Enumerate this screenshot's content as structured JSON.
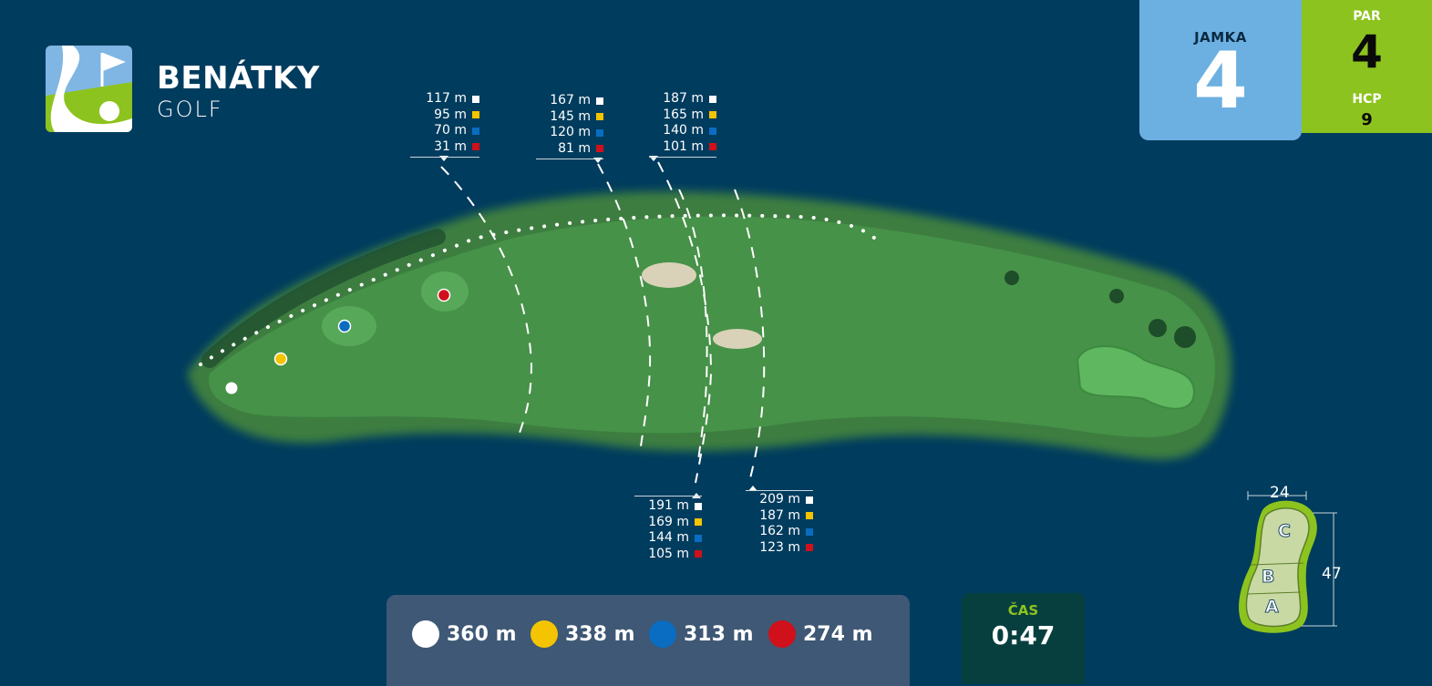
{
  "brand": {
    "name": "BENÁTKY",
    "subtitle": "GOLF"
  },
  "hole": {
    "label": "JAMKA",
    "number": "4"
  },
  "par": {
    "label": "PAR",
    "value": "4"
  },
  "hcp": {
    "label": "HCP",
    "value": "9"
  },
  "tee_colors": {
    "white": "#ffffff",
    "yellow": "#f5c400",
    "blue": "#0a6dc2",
    "red": "#d0101a"
  },
  "markers": [
    {
      "rows": [
        "117 m",
        "95 m",
        "70 m",
        "31 m"
      ]
    },
    {
      "rows": [
        "167 m",
        "145 m",
        "120 m",
        "81 m"
      ]
    },
    {
      "rows": [
        "187 m",
        "165 m",
        "140 m",
        "101 m"
      ]
    },
    {
      "rows": [
        "191 m",
        "169 m",
        "144 m",
        "105 m"
      ]
    },
    {
      "rows": [
        "209 m",
        "187 m",
        "162 m",
        "123 m"
      ]
    }
  ],
  "totals": [
    {
      "tee": "white",
      "distance": "360 m"
    },
    {
      "tee": "yellow",
      "distance": "338 m"
    },
    {
      "tee": "blue",
      "distance": "313 m"
    },
    {
      "tee": "red",
      "distance": "274 m"
    }
  ],
  "time": {
    "label": "ČAS",
    "value": "0:47"
  },
  "green": {
    "width": "24",
    "depth": "47",
    "zones": [
      "C",
      "B",
      "A"
    ]
  }
}
